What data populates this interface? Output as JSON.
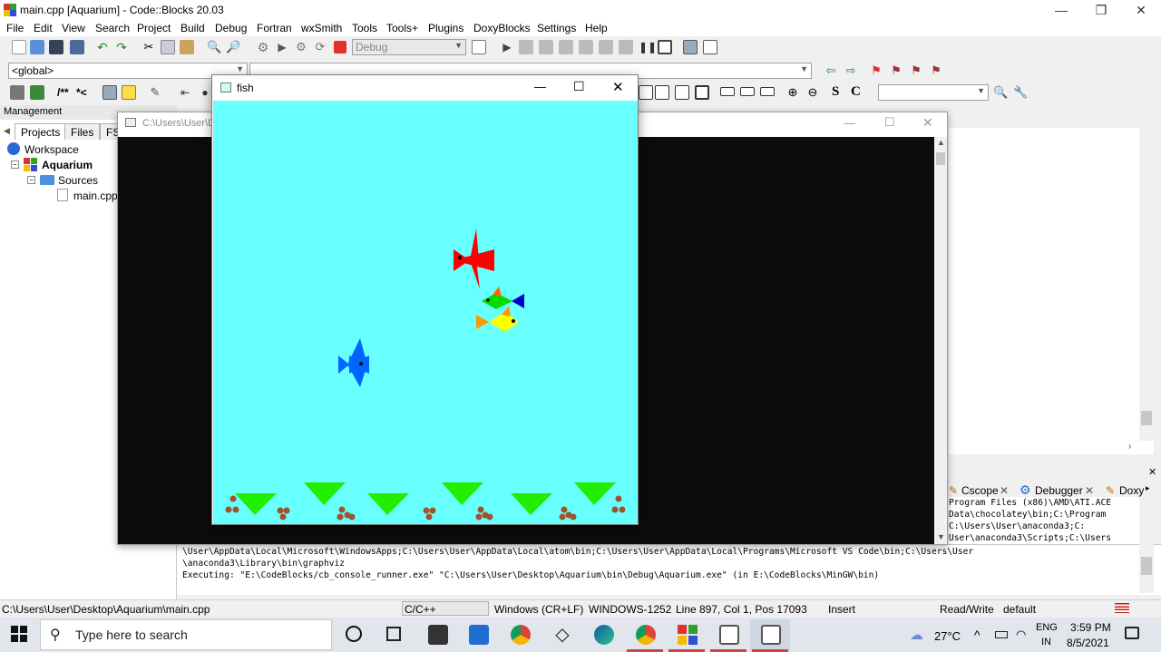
{
  "window": {
    "title": "main.cpp [Aquarium] - Code::Blocks 20.03",
    "minimize": "—",
    "maximize": "❐",
    "close": "✕"
  },
  "menu": [
    "File",
    "Edit",
    "View",
    "Search",
    "Project",
    "Build",
    "Debug",
    "Fortran",
    "wxSmith",
    "Tools",
    "Tools+",
    "Plugins",
    "DoxyBlocks",
    "Settings",
    "Help"
  ],
  "toolbar": {
    "build_target": "Debug",
    "scope": "<global>"
  },
  "management": {
    "header": "Management",
    "tabs": [
      "Projects",
      "Files",
      "FS"
    ],
    "tree": {
      "workspace": "Workspace",
      "project": "Aquarium",
      "folder": "Sources",
      "file": "main.cpp"
    }
  },
  "console_window": {
    "title": "C:\\Users\\User\\D"
  },
  "fish_window": {
    "title": "fish",
    "minimize": "—",
    "maximize": "☐",
    "close": "✕"
  },
  "logs": {
    "tabs": [
      "Cscope",
      "Debugger",
      "Doxy"
    ],
    "right_lines": [
      "Program Files (x86)\\AMD\\ATI.ACE",
      "Data\\chocolatey\\bin;C:\\Program",
      "C:\\Users\\User\\anaconda3;C:",
      "User\\anaconda3\\Scripts;C:\\Users"
    ],
    "lines": [
      "\\User\\AppData\\Local\\Microsoft\\WindowsApps;C:\\Users\\User\\AppData\\Local\\atom\\bin;C:\\Users\\User\\AppData\\Local\\Programs\\Microsoft VS Code\\bin;C:\\Users\\User",
      "\\anaconda3\\Library\\bin\\graphviz",
      "Executing: \"E:\\CodeBlocks/cb_console_runner.exe\" \"C:\\Users\\User\\Desktop\\Aquarium\\bin\\Debug\\Aquarium.exe\"  (in E:\\CodeBlocks\\MinGW\\bin)"
    ]
  },
  "status": {
    "path": "C:\\Users\\User\\Desktop\\Aquarium\\main.cpp",
    "language": "C/C++",
    "line_endings": "Windows (CR+LF)",
    "encoding": "WINDOWS-1252",
    "position": "Line 897, Col 1, Pos 17093",
    "mode": "Insert",
    "access": "Read/Write",
    "profile": "default"
  },
  "taskbar": {
    "search_placeholder": "Type here to search",
    "weather": "27°C",
    "language_line1": "ENG",
    "language_line2": "IN",
    "time": "3:59 PM",
    "date": "8/5/2021"
  },
  "colors": {
    "aquarium_water": "#68ffff",
    "fish_red": "#ff0000",
    "fish_green": "#00dd00",
    "fish_blue": "#0066ff",
    "fish_yellow": "#ffff00",
    "grass": "#22ee00",
    "pebble": "#8b4513"
  }
}
